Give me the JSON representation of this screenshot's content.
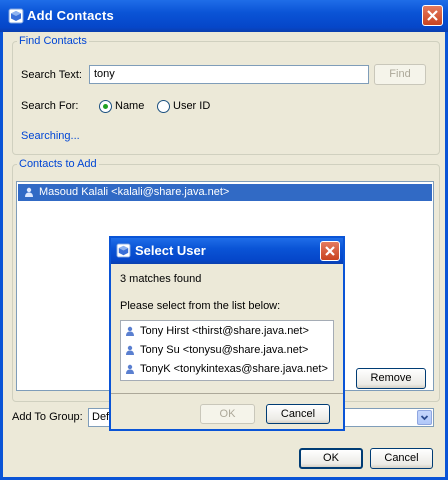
{
  "window": {
    "title": "Add Contacts",
    "icon": "app-cube-icon"
  },
  "find_contacts": {
    "legend": "Find Contacts",
    "search_text_label": "Search Text:",
    "search_text_value": "tony",
    "find_button": "Find",
    "search_for_label": "Search For:",
    "radio_name_label": "Name",
    "radio_name_selected": true,
    "radio_userid_label": "User ID",
    "radio_userid_selected": false,
    "status": "Searching..."
  },
  "contacts_to_add": {
    "legend": "Contacts to Add",
    "items": [
      {
        "label": "Masoud Kalali <kalali@share.java.net>",
        "selected": true,
        "icon": "user-icon"
      }
    ],
    "remove_button": "Remove"
  },
  "add_to_group": {
    "label": "Add To Group:",
    "value": "Default"
  },
  "footer": {
    "ok_button": "OK",
    "cancel_button": "Cancel"
  },
  "select_user_dialog": {
    "title": "Select User",
    "match_count_text": "3 matches found",
    "instruction": "Please select from the list below:",
    "matches": [
      {
        "label": "Tony Hirst <thirst@share.java.net>",
        "icon": "user-icon"
      },
      {
        "label": "Tony Su <tonysu@share.java.net>",
        "icon": "user-icon"
      },
      {
        "label": "TonyK <tonykintexas@share.java.net>",
        "icon": "user-icon"
      }
    ],
    "ok_button": "OK",
    "ok_enabled": false,
    "cancel_button": "Cancel"
  },
  "colors": {
    "title_bar": "#0a54d6",
    "selection": "#316ac5",
    "group_legend": "#0046d5"
  }
}
